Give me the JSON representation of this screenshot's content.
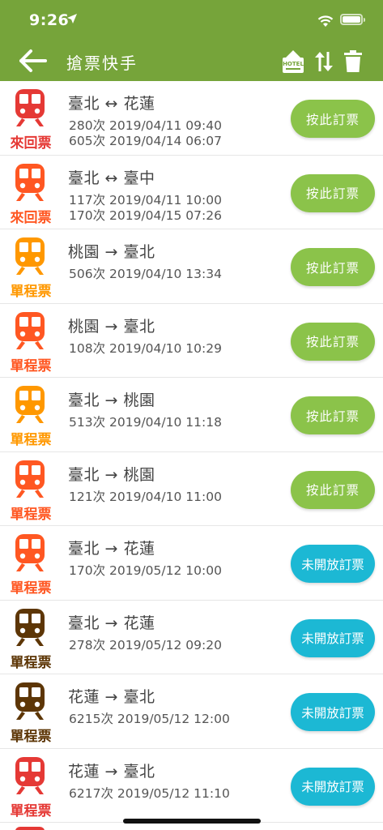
{
  "status_bar": {
    "time": "9:26"
  },
  "nav": {
    "title": "搶票快手",
    "hotel_sign": "HOTEL"
  },
  "colors": {
    "header": "#76a43a",
    "button_green": "#8bc34a",
    "button_blue": "#1cb8d4",
    "train_red": "#e53935",
    "train_orange": "#ff5722",
    "train_amber": "#ff9800",
    "train_brown": "#5d3606"
  },
  "tickets": [
    {
      "type": "來回票",
      "color": "#e53935",
      "route": "臺北 ↔ 花蓮",
      "line1": "280次 2019/04/11 09:40",
      "line2": "605次 2019/04/14 06:07",
      "action": "按此訂票",
      "action_style": "green"
    },
    {
      "type": "來回票",
      "color": "#ff5722",
      "route": "臺北 ↔ 臺中",
      "line1": "117次 2019/04/11 10:00",
      "line2": "170次 2019/04/15 07:26",
      "action": "按此訂票",
      "action_style": "green"
    },
    {
      "type": "單程票",
      "color": "#ff9800",
      "route": "桃園 → 臺北",
      "line1": "506次 2019/04/10 13:34",
      "line2": "",
      "action": "按此訂票",
      "action_style": "green"
    },
    {
      "type": "單程票",
      "color": "#ff5722",
      "route": "桃園 → 臺北",
      "line1": "108次 2019/04/10 10:29",
      "line2": "",
      "action": "按此訂票",
      "action_style": "green"
    },
    {
      "type": "單程票",
      "color": "#ff9800",
      "route": "臺北 → 桃園",
      "line1": "513次 2019/04/10 11:18",
      "line2": "",
      "action": "按此訂票",
      "action_style": "green"
    },
    {
      "type": "單程票",
      "color": "#ff5722",
      "route": "臺北 → 桃園",
      "line1": "121次 2019/04/10 11:00",
      "line2": "",
      "action": "按此訂票",
      "action_style": "green"
    },
    {
      "type": "單程票",
      "color": "#ff5722",
      "route": "臺北 → 花蓮",
      "line1": "170次 2019/05/12 10:00",
      "line2": "",
      "action": "未開放訂票",
      "action_style": "blue"
    },
    {
      "type": "單程票",
      "color": "#5d3606",
      "route": "臺北 → 花蓮",
      "line1": "278次 2019/05/12 09:20",
      "line2": "",
      "action": "未開放訂票",
      "action_style": "blue"
    },
    {
      "type": "單程票",
      "color": "#5d3606",
      "route": "花蓮 → 臺北",
      "line1": "6215次 2019/05/12 12:00",
      "line2": "",
      "action": "未開放訂票",
      "action_style": "blue"
    },
    {
      "type": "單程票",
      "color": "#e53935",
      "route": "花蓮 → 臺北",
      "line1": "6217次 2019/05/12 11:10",
      "line2": "",
      "action": "未開放訂票",
      "action_style": "blue"
    }
  ]
}
